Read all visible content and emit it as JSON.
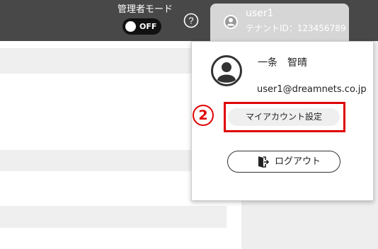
{
  "header": {
    "admin_mode_label": "管理者モード",
    "toggle_state": "OFF",
    "help_icon": "question-circle-icon",
    "user_tab": {
      "username": "user1",
      "tenant": "テナントID：123456789",
      "avatar_icon": "user-circle-icon"
    }
  },
  "dropdown": {
    "avatar_icon": "user-circle-icon",
    "full_name": "一条　智晴",
    "email": "user1@dreamnets.co.jp",
    "callout_number": "2",
    "account_settings_label": "マイアカウント設定",
    "logout_label": "ログアウト",
    "logout_icon": "logout-door-icon"
  },
  "colors": {
    "header_bg": "#484848",
    "highlight": "#e00000",
    "tab_bg": "#d6d6d6"
  }
}
